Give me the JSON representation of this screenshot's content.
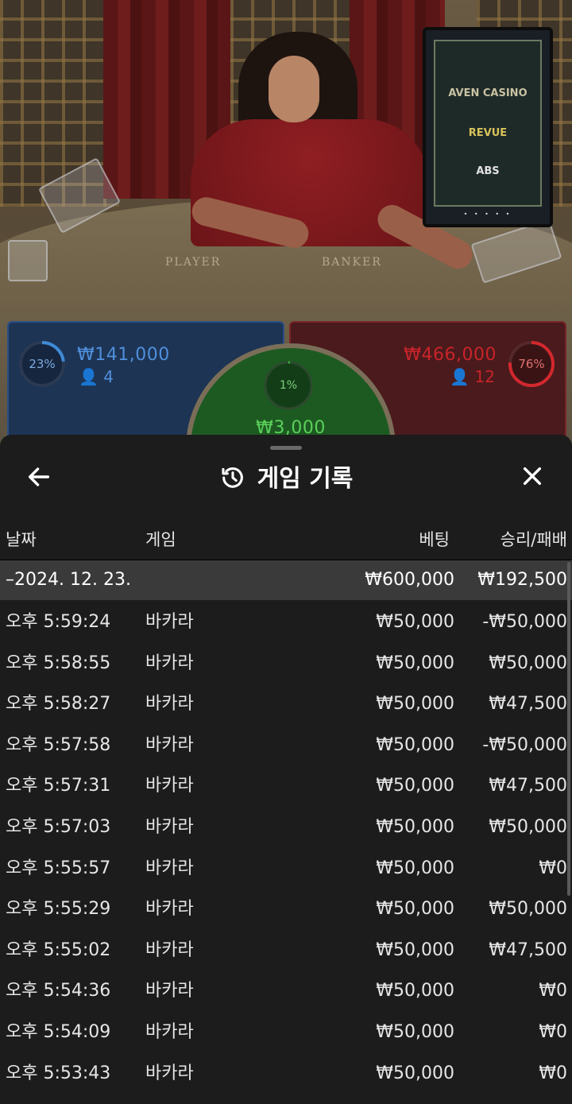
{
  "scene": {
    "table_player_label": "PLAYER",
    "table_banker_label": "BANKER",
    "screen_brands": [
      "AVEN CASINO",
      "REVUE",
      "ABS"
    ],
    "screen_page_dots": "• • • • •"
  },
  "bets": {
    "player": {
      "percent_label": "23%",
      "percent_value": 23,
      "amount": "₩141,000",
      "players": "4",
      "color": "#3f8ad6"
    },
    "banker": {
      "percent_label": "76%",
      "percent_value": 76,
      "amount": "₩466,000",
      "players": "12",
      "color": "#d2282e"
    },
    "tie": {
      "percent_label": "1%",
      "percent_value": 1,
      "amount": "₩3,000",
      "color": "#3ec43e"
    }
  },
  "history": {
    "title": "게임 기록",
    "back_icon": "arrow-left-icon",
    "history_icon": "history-clock-icon",
    "close_icon": "close-x-icon",
    "columns": {
      "date": "날짜",
      "game": "게임",
      "bet": "베팅",
      "result": "승리/패배"
    },
    "date_group": {
      "date": "–2024. 12. 23.",
      "bet_total": "₩600,000",
      "result_total": "₩192,500"
    },
    "rows": [
      {
        "time": "오후 5:59:24",
        "game": "바카라",
        "bet": "₩50,000",
        "result": "-₩50,000"
      },
      {
        "time": "오후 5:58:55",
        "game": "바카라",
        "bet": "₩50,000",
        "result": "₩50,000"
      },
      {
        "time": "오후 5:58:27",
        "game": "바카라",
        "bet": "₩50,000",
        "result": "₩47,500"
      },
      {
        "time": "오후 5:57:58",
        "game": "바카라",
        "bet": "₩50,000",
        "result": "-₩50,000"
      },
      {
        "time": "오후 5:57:31",
        "game": "바카라",
        "bet": "₩50,000",
        "result": "₩47,500"
      },
      {
        "time": "오후 5:57:03",
        "game": "바카라",
        "bet": "₩50,000",
        "result": "₩50,000"
      },
      {
        "time": "오후 5:55:57",
        "game": "바카라",
        "bet": "₩50,000",
        "result": "₩0"
      },
      {
        "time": "오후 5:55:29",
        "game": "바카라",
        "bet": "₩50,000",
        "result": "₩50,000"
      },
      {
        "time": "오후 5:55:02",
        "game": "바카라",
        "bet": "₩50,000",
        "result": "₩47,500"
      },
      {
        "time": "오후 5:54:36",
        "game": "바카라",
        "bet": "₩50,000",
        "result": "₩0"
      },
      {
        "time": "오후 5:54:09",
        "game": "바카라",
        "bet": "₩50,000",
        "result": "₩0"
      },
      {
        "time": "오후 5:53:43",
        "game": "바카라",
        "bet": "₩50,000",
        "result": "₩0"
      }
    ]
  }
}
